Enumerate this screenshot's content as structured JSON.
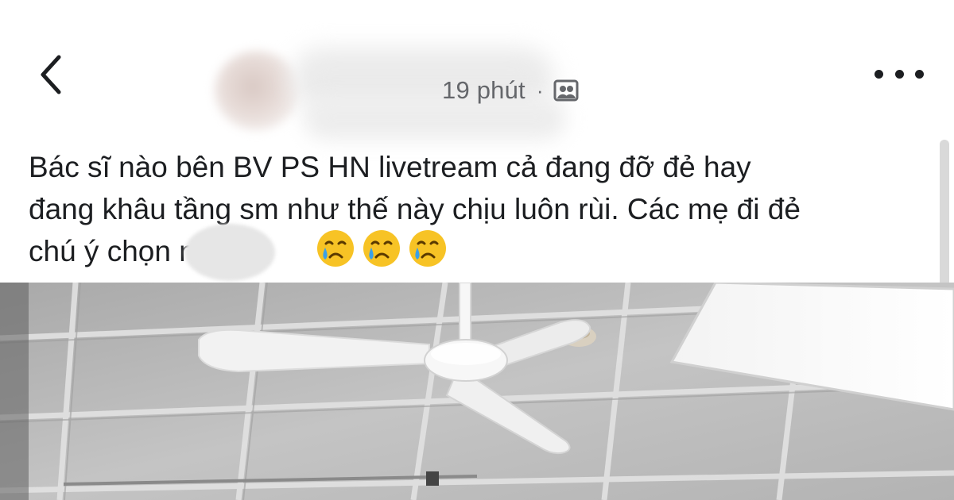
{
  "post": {
    "time": "19 phút",
    "separator": "·",
    "text": "Bác sĩ nào bên BV PS HN livetream cả đang đỡ đẻ hay\nđang khâu tầng sm như thế này chịu luôn rùi. Các mẹ đi đẻ\nchú ý chọn       nha",
    "emojis": [
      "crying-face-emoji",
      "crying-face-emoji",
      "crying-face-emoji"
    ]
  },
  "icons": {
    "back": "chevron-left-icon",
    "more": "more-horizontal-icon",
    "audience": "photo-album-icon"
  },
  "colors": {
    "text": "#1c1e21",
    "meta": "#65676b",
    "ceiling": "#bdbdbd",
    "fan": "#f5f5f5"
  }
}
